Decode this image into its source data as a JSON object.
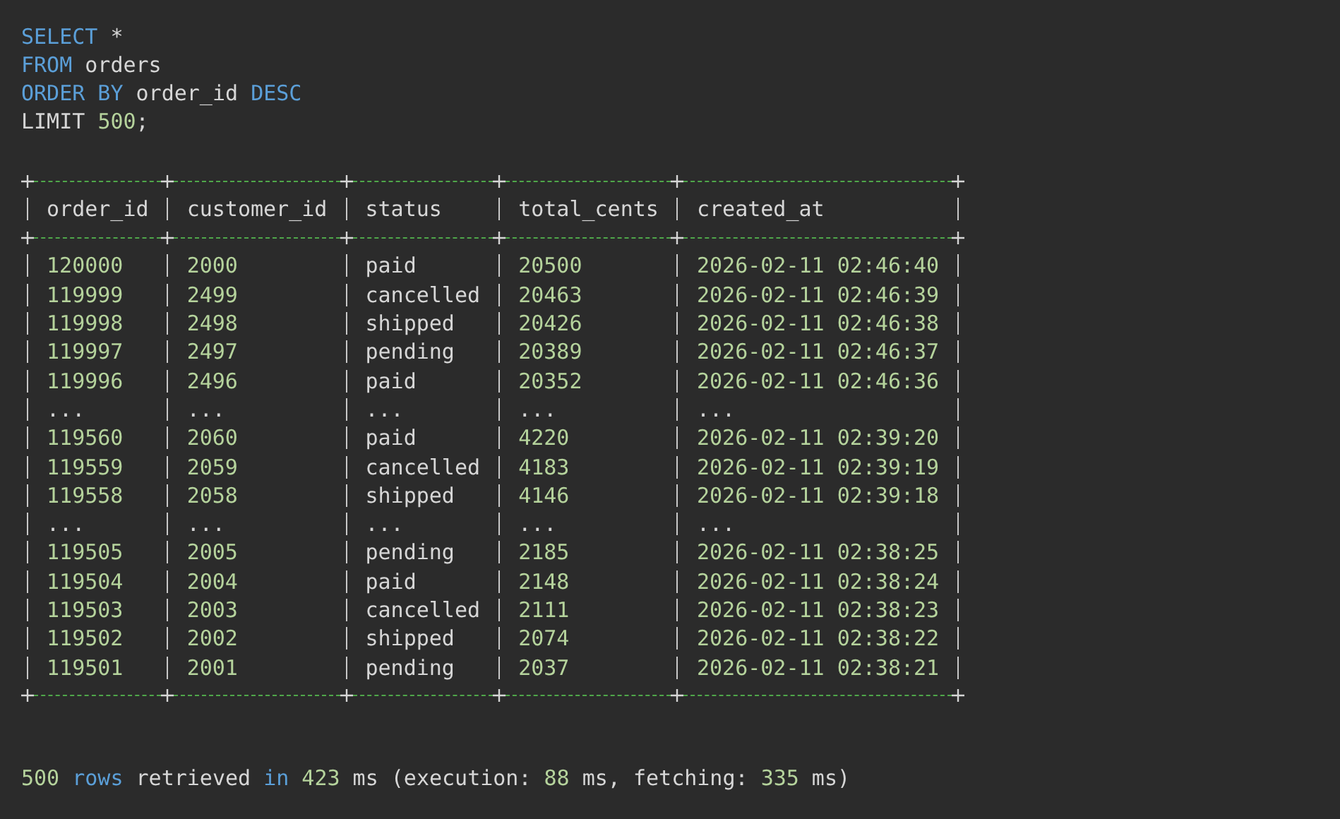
{
  "query": [
    [
      {
        "text": "SELECT",
        "kind": "keyword"
      },
      {
        "text": " *",
        "kind": "plain"
      }
    ],
    [
      {
        "text": "FROM",
        "kind": "keyword"
      },
      {
        "text": " orders",
        "kind": "plain"
      }
    ],
    [
      {
        "text": "ORDER BY",
        "kind": "keyword"
      },
      {
        "text": " order_id ",
        "kind": "plain"
      },
      {
        "text": "DESC",
        "kind": "keyword"
      }
    ],
    [
      {
        "text": "LIMIT ",
        "kind": "plain"
      },
      {
        "text": "500",
        "kind": "number"
      },
      {
        "text": ";",
        "kind": "plain"
      }
    ]
  ],
  "table": {
    "columns": [
      {
        "name": "order_id",
        "kind": "number"
      },
      {
        "name": "customer_id",
        "kind": "number"
      },
      {
        "name": "status",
        "kind": "text"
      },
      {
        "name": "total_cents",
        "kind": "number"
      },
      {
        "name": "created_at",
        "kind": "number"
      }
    ],
    "rows": [
      {
        "kind": "data",
        "cells": [
          "120000",
          "2000",
          "paid",
          "20500",
          "2026-02-11 02:46:40"
        ]
      },
      {
        "kind": "data",
        "cells": [
          "119999",
          "2499",
          "cancelled",
          "20463",
          "2026-02-11 02:46:39"
        ]
      },
      {
        "kind": "data",
        "cells": [
          "119998",
          "2498",
          "shipped",
          "20426",
          "2026-02-11 02:46:38"
        ]
      },
      {
        "kind": "data",
        "cells": [
          "119997",
          "2497",
          "pending",
          "20389",
          "2026-02-11 02:46:37"
        ]
      },
      {
        "kind": "data",
        "cells": [
          "119996",
          "2496",
          "paid",
          "20352",
          "2026-02-11 02:46:36"
        ]
      },
      {
        "kind": "gap",
        "cells": [
          "...",
          "...",
          "...",
          "...",
          "..."
        ]
      },
      {
        "kind": "data",
        "cells": [
          "119560",
          "2060",
          "paid",
          "4220",
          "2026-02-11 02:39:20"
        ]
      },
      {
        "kind": "data",
        "cells": [
          "119559",
          "2059",
          "cancelled",
          "4183",
          "2026-02-11 02:39:19"
        ]
      },
      {
        "kind": "data",
        "cells": [
          "119558",
          "2058",
          "shipped",
          "4146",
          "2026-02-11 02:39:18"
        ]
      },
      {
        "kind": "gap",
        "cells": [
          "...",
          "...",
          "...",
          "...",
          "..."
        ]
      },
      {
        "kind": "data",
        "cells": [
          "119505",
          "2005",
          "pending",
          "2185",
          "2026-02-11 02:38:25"
        ]
      },
      {
        "kind": "data",
        "cells": [
          "119504",
          "2004",
          "paid",
          "2148",
          "2026-02-11 02:38:24"
        ]
      },
      {
        "kind": "data",
        "cells": [
          "119503",
          "2003",
          "cancelled",
          "2111",
          "2026-02-11 02:38:23"
        ]
      },
      {
        "kind": "data",
        "cells": [
          "119502",
          "2002",
          "shipped",
          "2074",
          "2026-02-11 02:38:22"
        ]
      },
      {
        "kind": "data",
        "cells": [
          "119501",
          "2001",
          "pending",
          "2037",
          "2026-02-11 02:38:21"
        ]
      }
    ]
  },
  "status_line": [
    {
      "text": "500",
      "kind": "number"
    },
    {
      "text": " rows",
      "kind": "keyword"
    },
    {
      "text": " retrieved ",
      "kind": "plain"
    },
    {
      "text": "in",
      "kind": "keyword"
    },
    {
      "text": " 423",
      "kind": "number"
    },
    {
      "text": " ms (execution: ",
      "kind": "plain"
    },
    {
      "text": "88",
      "kind": "number"
    },
    {
      "text": " ms, fetching: ",
      "kind": "plain"
    },
    {
      "text": "335",
      "kind": "number"
    },
    {
      "text": " ms)",
      "kind": "plain"
    }
  ]
}
